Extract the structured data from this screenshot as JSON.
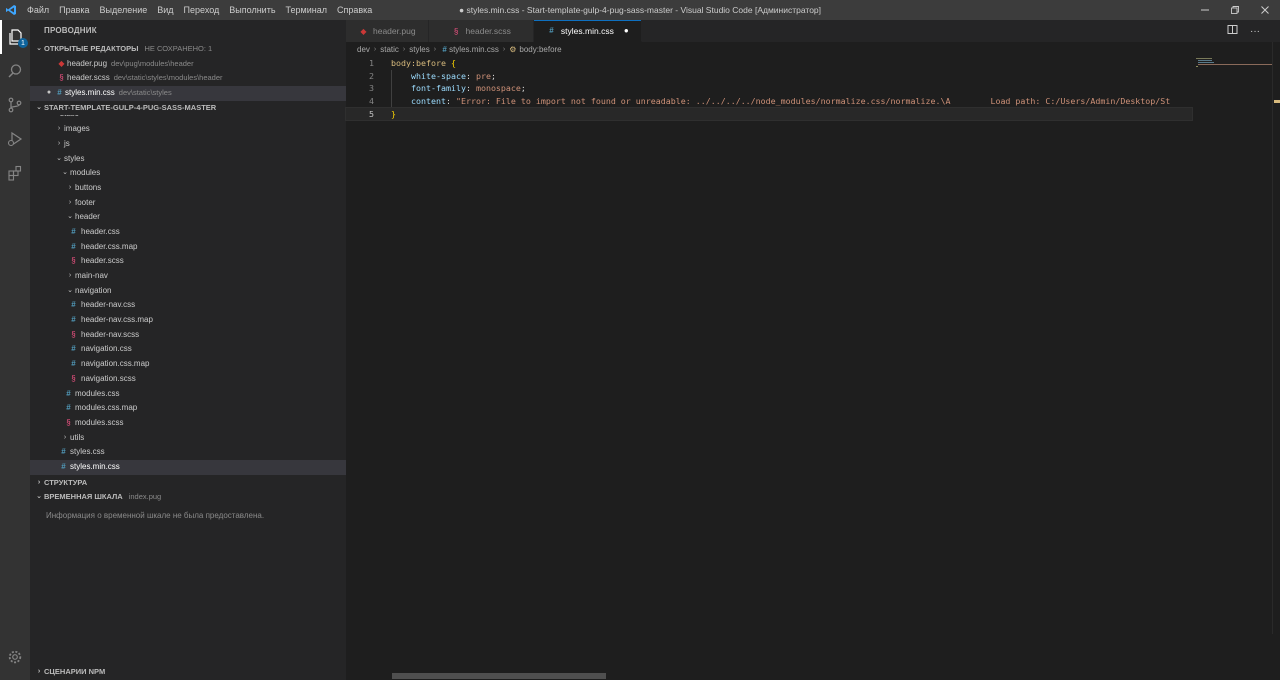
{
  "titlebar": {
    "menu": [
      "Файл",
      "Правка",
      "Выделение",
      "Вид",
      "Переход",
      "Выполнить",
      "Терминал",
      "Справка"
    ],
    "title": "● styles.min.css - Start-template-gulp-4-pug-sass-master - Visual Studio Code [Администратор]"
  },
  "activity": {
    "explorer_badge": "1"
  },
  "sidebar": {
    "title": "ПРОВОДНИК",
    "open_editors": {
      "label": "ОТКРЫТЫЕ РЕДАКТОРЫ",
      "unsaved": "НЕ СОХРАНЕНО: 1",
      "items": [
        {
          "name": "header.pug",
          "path": "dev\\pug\\modules\\header"
        },
        {
          "name": "header.scss",
          "path": "dev\\static\\styles\\modules\\header"
        },
        {
          "name": "styles.min.css",
          "path": "dev\\static\\styles"
        }
      ]
    },
    "project": {
      "label": "START-TEMPLATE-GULP-4-PUG-SASS-MASTER",
      "tree": [
        "static",
        "images",
        "js",
        "styles",
        "modules",
        "buttons",
        "footer",
        "header",
        "header.css",
        "header.css.map",
        "header.scss",
        "main-nav",
        "navigation",
        "header-nav.css",
        "header-nav.css.map",
        "header-nav.scss",
        "navigation.css",
        "navigation.css.map",
        "navigation.scss",
        "modules.css",
        "modules.css.map",
        "modules.scss",
        "utils",
        "styles.css",
        "styles.min.css"
      ]
    },
    "outline": {
      "label": "СТРУКТУРА"
    },
    "timeline": {
      "label": "ВРЕМЕННАЯ ШКАЛА",
      "file": "index.pug",
      "message": "Информация о временной шкале не была предоставлена."
    },
    "npm": {
      "label": "СЦЕНАРИИ NPM"
    }
  },
  "tabs": [
    {
      "label": "header.pug"
    },
    {
      "label": "header.scss"
    },
    {
      "label": "styles.min.css"
    }
  ],
  "breadcrumbs": [
    "dev",
    "static",
    "styles",
    "styles.min.css",
    "body:before"
  ],
  "code": {
    "line_numbers": [
      "1",
      "2",
      "3",
      "4",
      "5"
    ],
    "selector": "body",
    "pseudo": ":before",
    "open_brace": "{",
    "close_brace": "}",
    "prop1": "white-space",
    "val1": "pre",
    "prop2": "font-family",
    "val2": "monospace",
    "prop3": "content",
    "val3": "\"Error: File to import not found or unreadable: ../../../../node_modules/normalize.css/normalize.\\A        Load path: C:/Users/Admin/Desktop/St"
  }
}
